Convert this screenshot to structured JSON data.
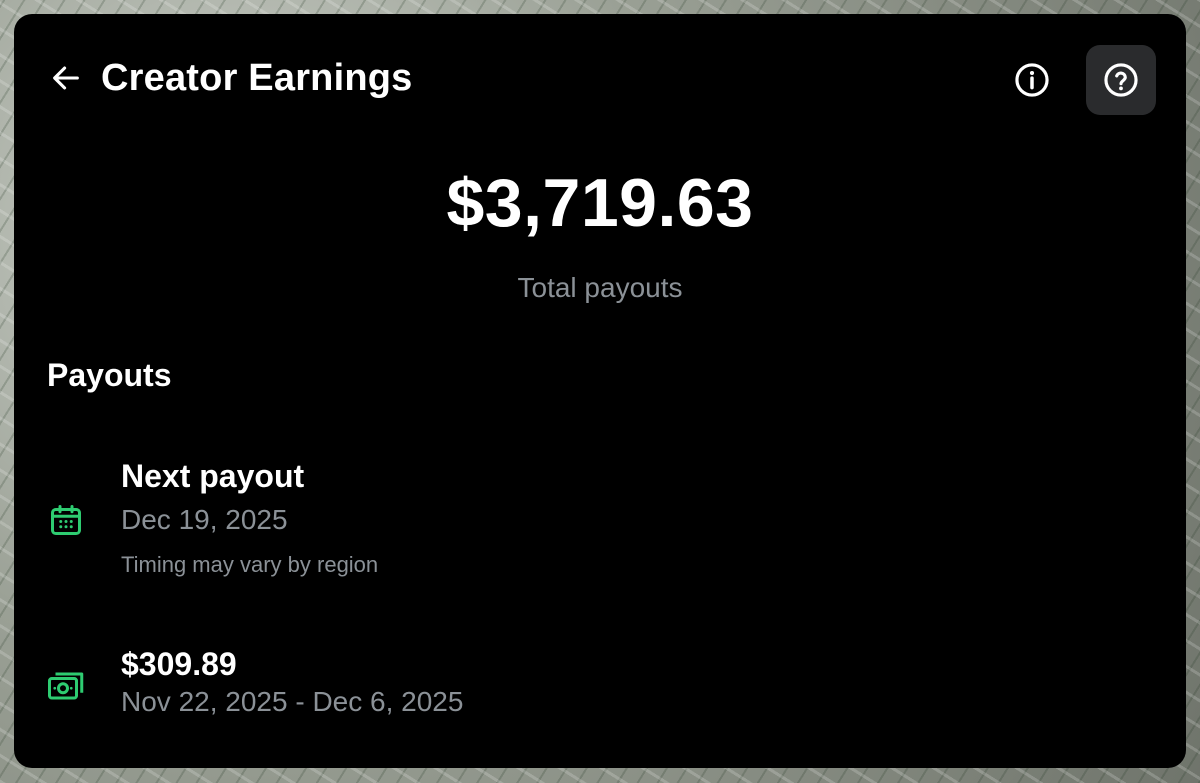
{
  "header": {
    "title": "Creator Earnings",
    "back_icon": "arrow-left-icon",
    "info_icon": "info-circle-icon",
    "help_icon": "question-circle-icon"
  },
  "summary": {
    "total_amount": "$3,719.63",
    "total_label": "Total payouts"
  },
  "payouts": {
    "heading": "Payouts",
    "next": {
      "title": "Next payout",
      "date": "Dec 19, 2025",
      "note": "Timing may vary by region",
      "icon": "calendar-icon"
    },
    "items": [
      {
        "amount": "$309.89",
        "period": "Nov 22, 2025 - Dec 6, 2025",
        "icon": "cash-icon"
      }
    ]
  },
  "colors": {
    "background": "#000000",
    "text_primary": "#ffffff",
    "text_secondary": "#8b9197",
    "accent_green": "#2ecc71",
    "help_button_bg": "#2a2b2d"
  }
}
